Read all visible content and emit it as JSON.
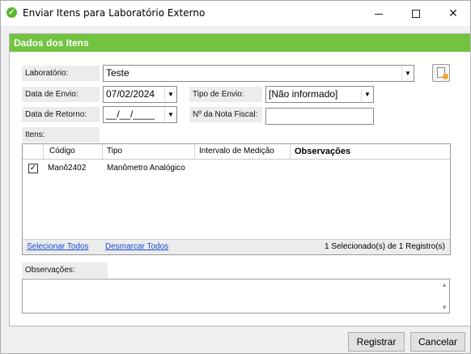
{
  "window": {
    "title": "Enviar Itens para Laboratório Externo",
    "icon": "check-circle-icon"
  },
  "panel": {
    "header": "Dados dos Itens"
  },
  "form": {
    "laboratorio_label": "Laboratório:",
    "laboratorio_value": "Teste",
    "data_envio_label": "Data de Envio:",
    "data_envio_value": "07/02/2024",
    "tipo_envio_label": "Tipo de Envio:",
    "tipo_envio_value": "[Não informado]",
    "data_retorno_label": "Data de Retorno:",
    "data_retorno_value": "__/__/____",
    "nota_fiscal_label": "Nº da Nota Fiscal:",
    "nota_fiscal_value": "",
    "itens_label": "Itens:"
  },
  "grid": {
    "columns": [
      "Código",
      "Tipo",
      "Intervalo de Medição",
      "Observações"
    ],
    "rows": [
      {
        "checked": true,
        "codigo": "Manô2402",
        "tipo": "Manômetro Analógico",
        "intervalo": "",
        "observacoes": ""
      }
    ],
    "select_all": "Selecionar Todos",
    "deselect_all": "Desmarcar Todos",
    "status": "1 Selecionado(s) de 1 Registro(s)"
  },
  "observacoes": {
    "label": "Observações:",
    "value": ""
  },
  "buttons": {
    "registrar": "Registrar",
    "cancelar": "Cancelar"
  },
  "colors": {
    "header_green": "#72c340",
    "link_blue": "#1a4ad4"
  }
}
